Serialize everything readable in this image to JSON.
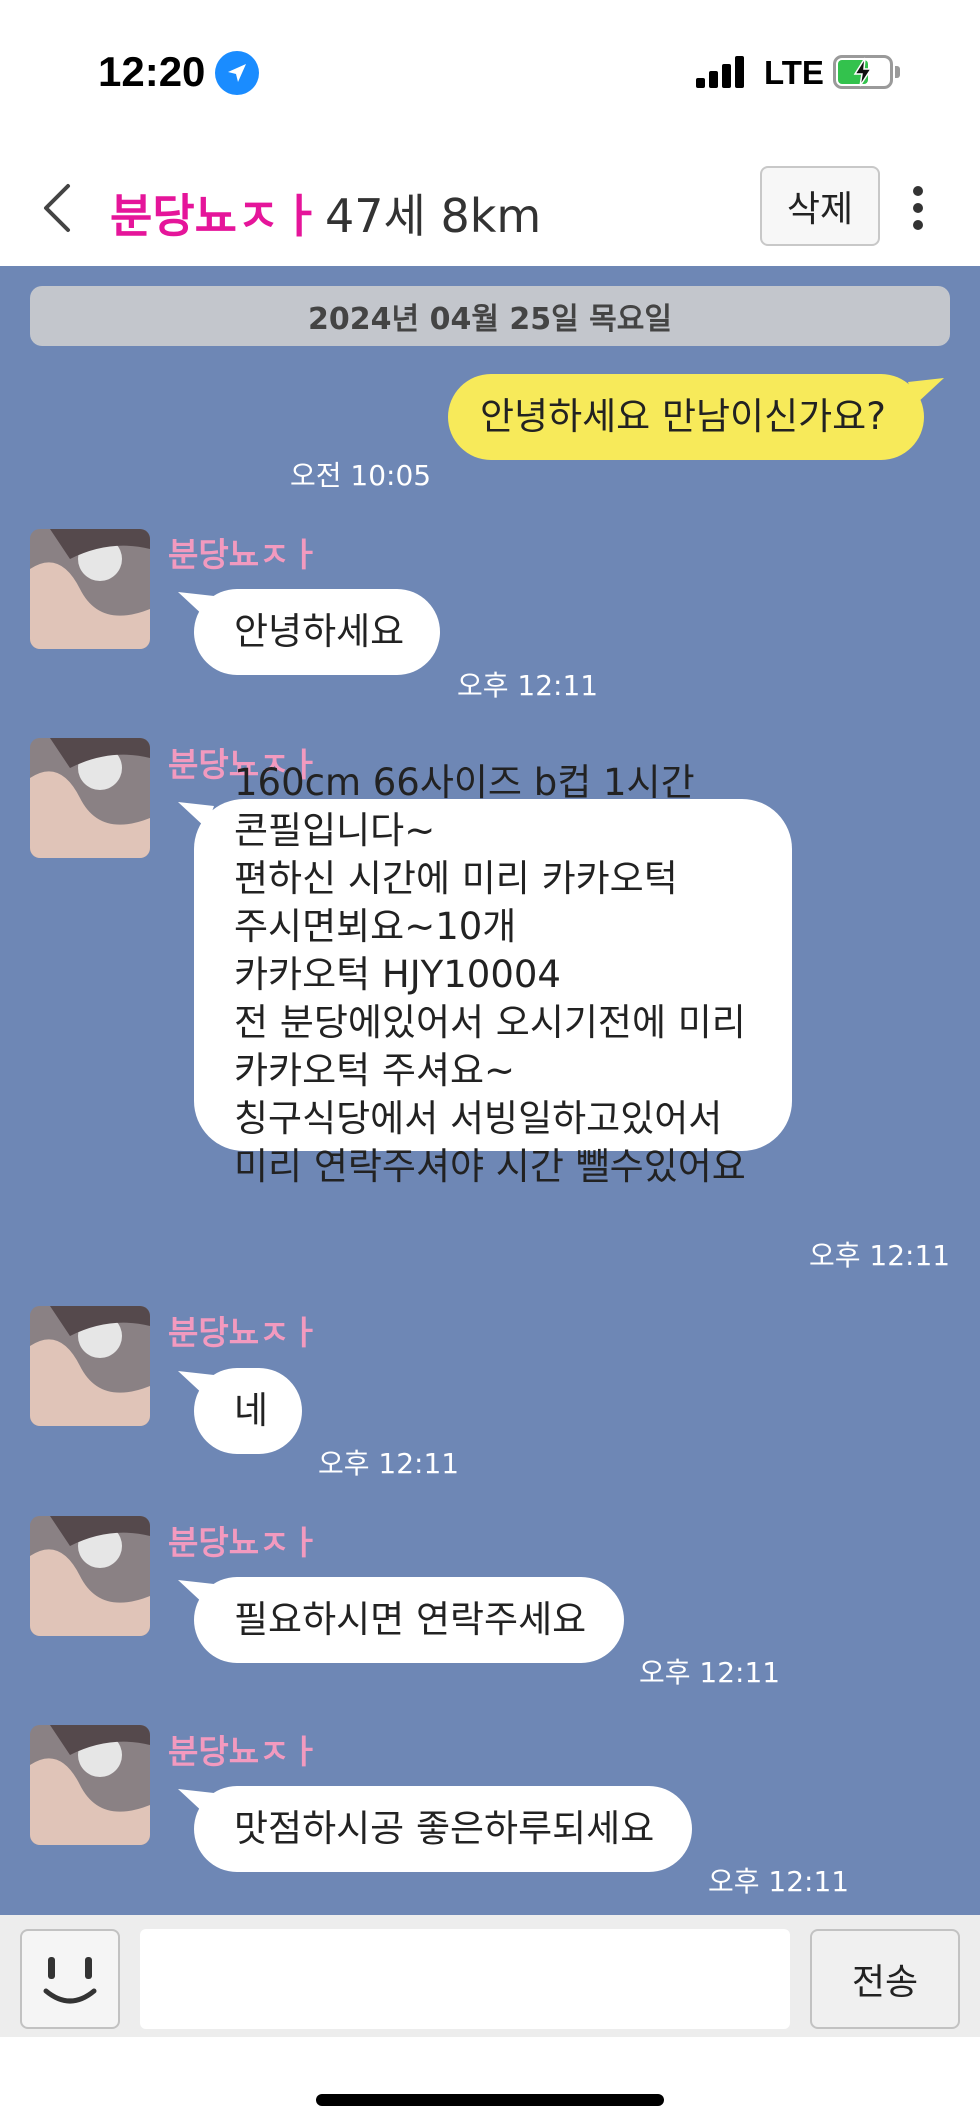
{
  "status_bar": {
    "time": "12:20",
    "network": "LTE",
    "icons": [
      "location-arrow-icon",
      "signal-bars-icon",
      "battery-charging-icon"
    ]
  },
  "header": {
    "name": "분당뇨ㅈㅏ",
    "info": "47세 8km",
    "delete_label": "삭제",
    "icons": [
      "chevron-left-icon",
      "more-vertical-icon"
    ]
  },
  "chat": {
    "date": "2024년 04월 25일 목요일",
    "messages": [
      {
        "from": "me",
        "text": "안녕하세요 만남이신가요?",
        "time": "오전 10:05"
      },
      {
        "from": "분당뇨ㅈㅏ",
        "text": "안녕하세요",
        "time": "오후 12:11"
      },
      {
        "from": "분당뇨ㅈㅏ",
        "lines": [
          "160cm 66사이즈 b컵 1시간",
          "콘필입니다~",
          "편하신 시간에 미리 카카오턱",
          "주시면뵈요~10개",
          "카카오턱 HJY10004",
          "전 분당에있어서 오시기전에 미리",
          "카카오턱 주셔요~",
          "칭구식당에서 서빙일하고있어서",
          "미리 연락주셔야 시간 뺄수있어요"
        ],
        "time": "오후 12:11"
      },
      {
        "from": "분당뇨ㅈㅏ",
        "text": "네",
        "time": "오후 12:11"
      },
      {
        "from": "분당뇨ㅈㅏ",
        "text": "필요하시면 연락주세요",
        "time": "오후 12:11"
      },
      {
        "from": "분당뇨ㅈㅏ",
        "text": "맛점하시공 좋은하루되세요",
        "time": "오후 12:11"
      }
    ]
  },
  "input_bar": {
    "value": "",
    "send_label": "전송",
    "icons": [
      "smiley-icon"
    ]
  },
  "colors": {
    "chat_bg": "#6e87b5",
    "my_bubble": "#f7ea5a",
    "their_bubble": "#ffffff",
    "header_name": "#e5159a",
    "sender_name": "#f29abf"
  }
}
